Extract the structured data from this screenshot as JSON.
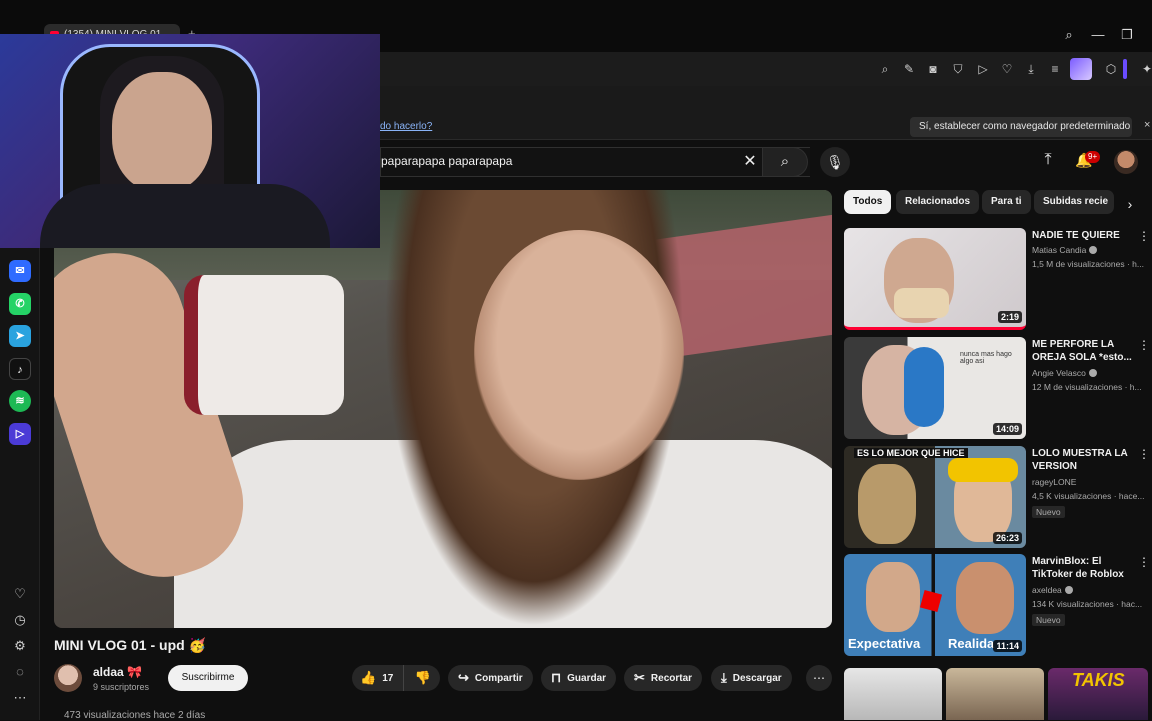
{
  "browser": {
    "tab_title": "(1354) MINI VLOG 01 ...",
    "new_tab": "+",
    "window_controls": [
      "search-icon",
      "minimize-icon",
      "restore-icon"
    ],
    "toolbar_icons": [
      "zoom-icon",
      "edit-icon",
      "camera-icon",
      "shield-icon",
      "play-icon",
      "heart-icon",
      "download-icon",
      "menu-icon",
      "extension-avatar",
      "cube-icon"
    ],
    "infobar": {
      "link_text": "do hacerlo?",
      "button_label": "Sí, establecer como navegador predeterminado",
      "close": "×"
    }
  },
  "sidebar": {
    "apps": [
      {
        "name": "messenger-icon",
        "glyph": "✉",
        "color": "#2f6bff"
      },
      {
        "name": "whatsapp-icon",
        "glyph": "✆",
        "color": "#25d366"
      },
      {
        "name": "telegram-icon",
        "glyph": "➤",
        "color": "#2aa3df"
      },
      {
        "name": "tiktok-icon",
        "glyph": "♪",
        "color": "#111111"
      },
      {
        "name": "spotify-icon",
        "glyph": "≋",
        "color": "#1db954"
      },
      {
        "name": "player-icon",
        "glyph": "▷",
        "color": "#4b3bd6"
      }
    ],
    "bottom": [
      "heart-icon",
      "clock-icon",
      "gear-icon",
      "bulb-icon",
      "more-icon"
    ]
  },
  "header": {
    "search_value": "paparapapa paparapapa",
    "clear": "✕",
    "notifications": "9+"
  },
  "video": {
    "title": "MINI VLOG 01 - upd 🥳",
    "channel": "aldaa 🎀",
    "subscribers": "9 suscriptores",
    "subscribe_label": "Suscribirme",
    "likes": "17",
    "share": "Compartir",
    "save": "Guardar",
    "clip": "Recortar",
    "download": "Descargar",
    "views_line": "473 visualizaciones  hace 2 días"
  },
  "chips": [
    {
      "label": "Todos",
      "active": true
    },
    {
      "label": "Relacionados",
      "active": false
    },
    {
      "label": "Para ti",
      "active": false
    },
    {
      "label": "Subidas recie",
      "active": false
    }
  ],
  "recommendations": [
    {
      "title": "NADIE TE QUIERE",
      "channel": "Matias Candia",
      "meta": "1,5 M de visualizaciones · h...",
      "duration": "2:19",
      "badge": ""
    },
    {
      "title": "ME PERFORE LA OREJA SOLA *esto...",
      "channel": "Angie Velasco",
      "meta": "12 M de visualizaciones · h...",
      "duration": "14:09",
      "badge": "",
      "thumb_text": "nunca mas hago algo asi"
    },
    {
      "title": "LOLO MUESTRA LA VERSION ORIGINAL...",
      "channel": "rageyLONE",
      "meta": "4,5 K visualizaciones · hace...",
      "duration": "26:23",
      "badge": "Nuevo",
      "thumb_text": "ES LO MEJOR QUE HICE"
    },
    {
      "title": "MarvinBlox: El TikToker de Roblox ...",
      "channel": "axeldea",
      "meta": "134 K visualizaciones · hac...",
      "duration": "11:14",
      "badge": "Nuevo",
      "thumb_text": "Expectativa",
      "thumb_text2": "Realida"
    }
  ],
  "bottom_thumb_text": "TAKIS"
}
